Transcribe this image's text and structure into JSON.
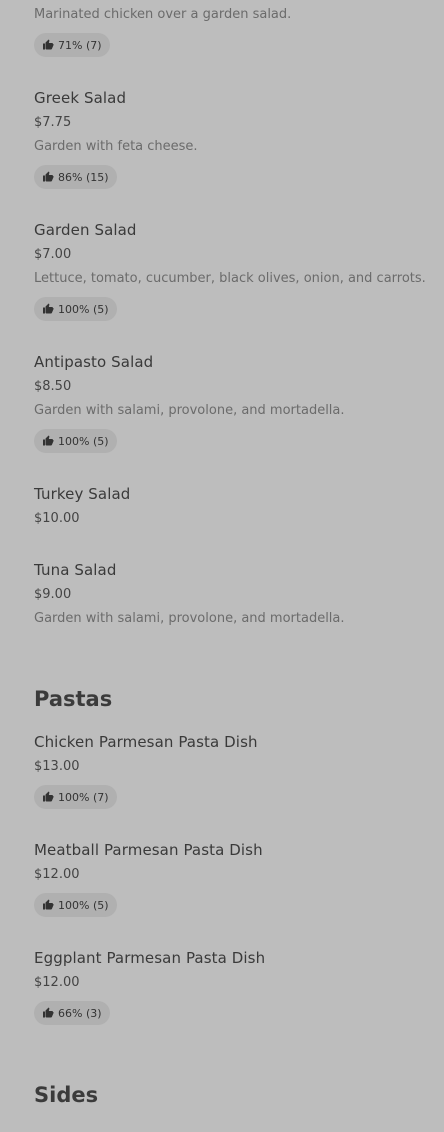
{
  "menu": {
    "partial_item": {
      "description": "Marinated chicken over a garden salad.",
      "rating": "71% (7)"
    },
    "salads": [
      {
        "name": "Greek Salad",
        "price": "$7.75",
        "description": "Garden with feta cheese.",
        "rating": "86% (15)"
      },
      {
        "name": "Garden Salad",
        "price": "$7.00",
        "description": "Lettuce, tomato, cucumber, black olives, onion, and carrots.",
        "rating": "100% (5)"
      },
      {
        "name": "Antipasto Salad",
        "price": "$8.50",
        "description": "Garden with salami, provolone, and mortadella.",
        "rating": "100% (5)"
      },
      {
        "name": "Turkey Salad",
        "price": "$10.00"
      },
      {
        "name": "Tuna Salad",
        "price": "$9.00",
        "description": "Garden with salami, provolone, and mortadella."
      }
    ],
    "pastas_title": "Pastas",
    "pastas": [
      {
        "name": "Chicken Parmesan Pasta Dish",
        "price": "$13.00",
        "rating": "100% (7)"
      },
      {
        "name": "Meatball Parmesan Pasta Dish",
        "price": "$12.00",
        "rating": "100% (5)"
      },
      {
        "name": "Eggplant Parmesan Pasta Dish",
        "price": "$12.00",
        "rating": "66% (3)"
      }
    ],
    "sides_title": "Sides"
  },
  "icons": {
    "rating": "thumbs-up-icon"
  }
}
